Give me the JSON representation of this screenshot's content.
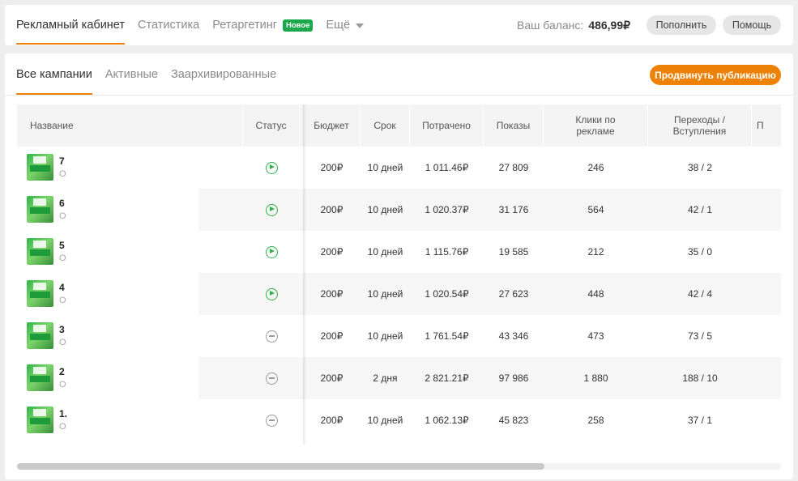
{
  "topnav": {
    "items": [
      {
        "label": "Рекламный кабинет",
        "active": true
      },
      {
        "label": "Статистика",
        "active": false
      },
      {
        "label": "Ретаргетинг",
        "active": false,
        "badge": "Новое"
      },
      {
        "label": "Ещё",
        "active": false
      }
    ],
    "balance_label": "Ваш баланс:",
    "balance_value": "486,99₽",
    "topup_label": "Пополнить",
    "help_label": "Помощь"
  },
  "subtabs": [
    {
      "label": "Все кампании",
      "active": true
    },
    {
      "label": "Активные",
      "active": false
    },
    {
      "label": "Заархивированные",
      "active": false
    }
  ],
  "promote_label": "Продвинуть публикацию",
  "table": {
    "columns": [
      "Название",
      "Статус",
      "Бюджет",
      "Срок",
      "Потрачено",
      "Показы",
      "Клики по рекламе",
      "Переходы / Вступления",
      "П"
    ],
    "rows": [
      {
        "title": "7",
        "sub": "О",
        "status": "active",
        "budget": "200₽",
        "term": "10 дней",
        "spent": "1 011.46₽",
        "shows": "27 809",
        "clicks": "246",
        "joins": "38 / 2"
      },
      {
        "title": "6",
        "sub": "О",
        "status": "active",
        "budget": "200₽",
        "term": "10 дней",
        "spent": "1 020.37₽",
        "shows": "31 176",
        "clicks": "564",
        "joins": "42 / 1"
      },
      {
        "title": "5",
        "sub": "О",
        "status": "active",
        "budget": "200₽",
        "term": "10 дней",
        "spent": "1 115.76₽",
        "shows": "19 585",
        "clicks": "212",
        "joins": "35 / 0"
      },
      {
        "title": "4",
        "sub": "О",
        "status": "active",
        "budget": "200₽",
        "term": "10 дней",
        "spent": "1 020.54₽",
        "shows": "27 623",
        "clicks": "448",
        "joins": "42 / 4"
      },
      {
        "title": "3",
        "sub": "О",
        "status": "stopped",
        "budget": "200₽",
        "term": "10 дней",
        "spent": "1 761.54₽",
        "shows": "43 346",
        "clicks": "473",
        "joins": "73 / 5"
      },
      {
        "title": "2",
        "sub": "О",
        "status": "stopped",
        "budget": "200₽",
        "term": "2 дня",
        "spent": "2 821.21₽",
        "shows": "97 986",
        "clicks": "1 880",
        "joins": "188 / 10"
      },
      {
        "title": "1.",
        "sub": "О",
        "status": "stopped",
        "budget": "200₽",
        "term": "10 дней",
        "spent": "1 062.13₽",
        "shows": "45 823",
        "clicks": "258",
        "joins": "37 / 1"
      }
    ]
  },
  "colors": {
    "accent": "#ee8208",
    "active_status": "#2db34a",
    "badge": "#1aa84a"
  },
  "icons": {
    "active_status": "play-circle-icon",
    "stopped_status": "minus-circle-icon",
    "more": "chevron-down-icon"
  },
  "scrollbar": {
    "thumb_fraction": 0.69
  }
}
